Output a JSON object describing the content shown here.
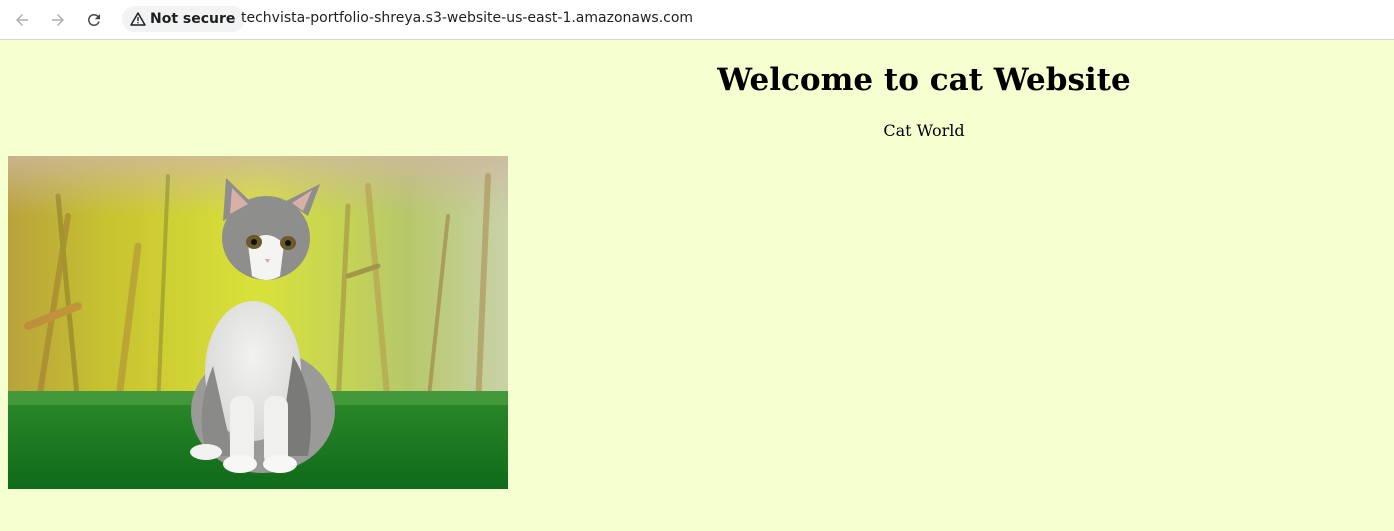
{
  "browser": {
    "security_label": "Not secure",
    "url": "techvista-portfolio-shreya.s3-website-us-east-1.amazonaws.com",
    "icons": [
      "back-arrow-icon",
      "forward-arrow-icon",
      "reload-icon",
      "warning-icon"
    ]
  },
  "page": {
    "title": "Welcome to cat Website",
    "subtitle": "Cat World",
    "background_color": "#f5ffcf"
  },
  "image": {
    "subject": "kitten"
  }
}
